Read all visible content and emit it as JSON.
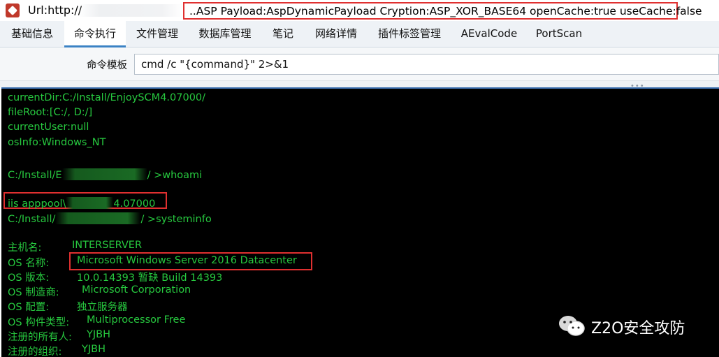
{
  "window": {
    "url_label": "Url:http://",
    "info": "..ASP Payload:AspDynamicPayload Cryption:ASP_XOR_BASE64 openCache:true useCache:false"
  },
  "tabs": [
    {
      "label": "基础信息"
    },
    {
      "label": "命令执行"
    },
    {
      "label": "文件管理"
    },
    {
      "label": "数据库管理"
    },
    {
      "label": "笔记"
    },
    {
      "label": "网络详情"
    },
    {
      "label": "插件标签管理"
    },
    {
      "label": "AEvalCode"
    },
    {
      "label": "PortScan"
    }
  ],
  "active_tab": "命令执行",
  "command_template": {
    "label": "命令模板",
    "value": "cmd /c \"{command}\" 2>&1"
  },
  "console": {
    "lines": {
      "current_dir": "currentDir:C:/Install/EnjoySCM4.07000/",
      "file_root": "fileRoot:[C:/, D:/]",
      "current_user": "currentUser:null",
      "os_info": "osInfo:Windows_NT",
      "prompt1_a": "C:/Install/E",
      "prompt1_b": "/ >whoami",
      "whoami_a": "iis apppool\\",
      "whoami_b": "4.07000",
      "prompt2_a": "C:/Install/",
      "prompt2_b": "/ >systeminfo"
    },
    "sysinfo": [
      {
        "key": "主机名:",
        "value": "INTERSERVER"
      },
      {
        "key": "OS 名称:",
        "value": "Microsoft Windows Server 2016 Datacenter"
      },
      {
        "key": "OS 版本:",
        "value": "10.0.14393 暂缺 Build 14393"
      },
      {
        "key": "OS 制造商:",
        "value": "Microsoft Corporation"
      },
      {
        "key": "OS 配置:",
        "value": "独立服务器"
      },
      {
        "key": "OS 构件类型:",
        "value": "Multiprocessor Free"
      },
      {
        "key": "注册的所有人:",
        "value": "YJBH"
      },
      {
        "key": "注册的组织:",
        "value": "YJBH"
      }
    ]
  },
  "watermark": {
    "text": "Z2O安全攻防",
    "icon": "wechat-icon"
  },
  "colors": {
    "console_text": "#27c93f",
    "console_bg": "#000000",
    "highlight": "#e03030",
    "tab_accent": "#3b82c4"
  }
}
